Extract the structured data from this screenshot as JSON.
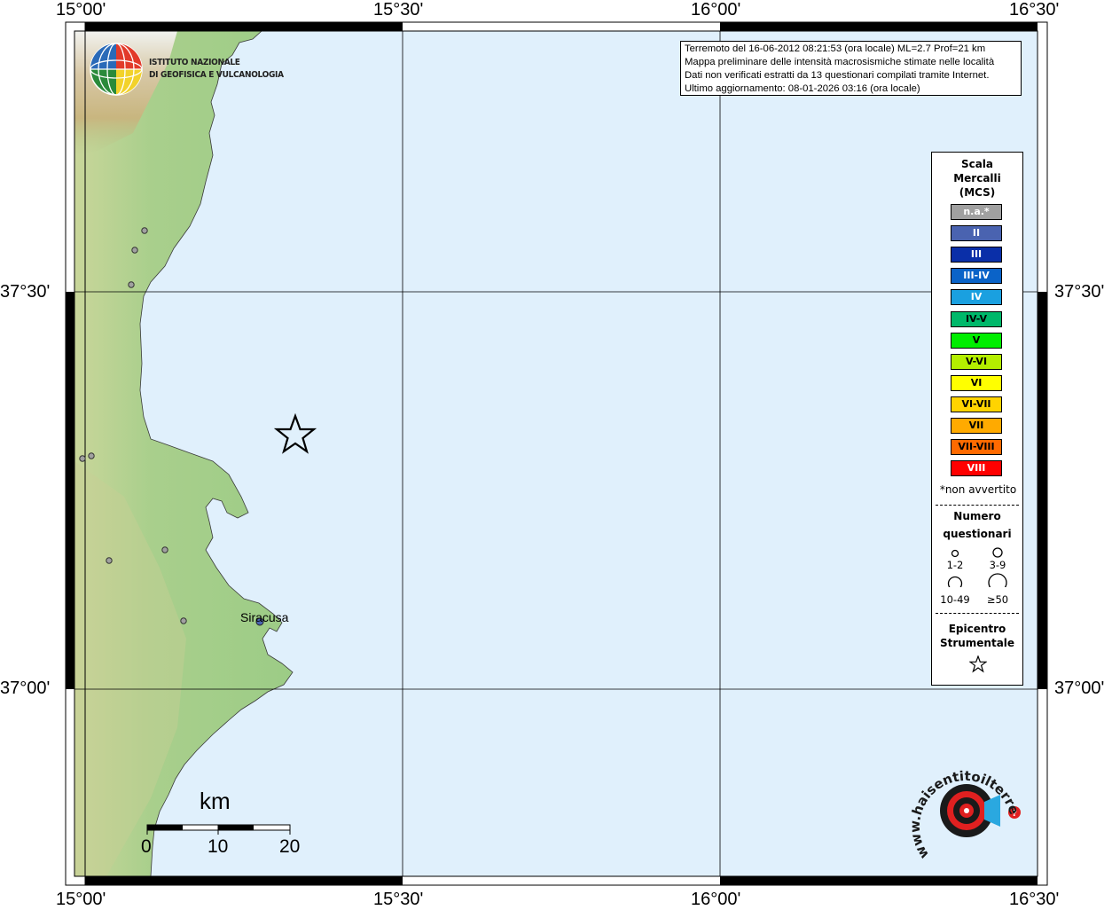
{
  "header": {
    "line1": "Terremoto del 16-06-2012 08:21:53 (ora locale) ML=2.7 Prof=21 km",
    "line2": "Mappa preliminare delle intensità macrosismiche stimate nelle località",
    "line3": "Dati non verificati estratti da 13 questionari compilati tramite Internet.",
    "line4": "Ultimo aggiornamento: 08-01-2026 03:16 (ora locale)"
  },
  "logo": {
    "line1": "ISTITUTO NAZIONALE",
    "line2": "DI GEOFISICA E VULCANOLOGIA",
    "site": "www.haisentitoilterremoto.it"
  },
  "axes": {
    "top": [
      "15°00'",
      "15°30'",
      "16°00'",
      "16°30'"
    ],
    "bottom": [
      "15°00'",
      "15°30'",
      "16°00'",
      "16°30'"
    ],
    "left": [
      "37°30'",
      "37°00'"
    ],
    "right": [
      "37°30'",
      "37°00'"
    ]
  },
  "legend": {
    "title_lines": [
      "Scala",
      "Mercalli",
      "(MCS)"
    ],
    "intensity_classes": [
      {
        "label": "n.a.*",
        "color": "#a0a0a0",
        "text_color": "#ffffff"
      },
      {
        "label": "II",
        "color": "#4a63b0",
        "text_color": "#ffffff"
      },
      {
        "label": "III",
        "color": "#0a2fa8",
        "text_color": "#ffffff"
      },
      {
        "label": "III-IV",
        "color": "#0a63c8",
        "text_color": "#ffffff"
      },
      {
        "label": "IV",
        "color": "#1aa0e0",
        "text_color": "#ffffff"
      },
      {
        "label": "IV-V",
        "color": "#00b86a",
        "text_color": "#000000"
      },
      {
        "label": "V",
        "color": "#00ee00",
        "text_color": "#000000"
      },
      {
        "label": "V-VI",
        "color": "#b4ee00",
        "text_color": "#000000"
      },
      {
        "label": "VI",
        "color": "#ffff00",
        "text_color": "#000000"
      },
      {
        "label": "VI-VII",
        "color": "#ffd400",
        "text_color": "#000000"
      },
      {
        "label": "VII",
        "color": "#ffaa00",
        "text_color": "#000000"
      },
      {
        "label": "VII-VIII",
        "color": "#ff6a00",
        "text_color": "#000000"
      },
      {
        "label": "VIII",
        "color": "#ff0000",
        "text_color": "#ffffff"
      }
    ],
    "note": "*non avvertito",
    "questionnaire_title_lines": [
      "Numero",
      "questionari"
    ],
    "questionnaire_classes": [
      "1-2",
      "3-9",
      "10-49",
      "≥50"
    ],
    "epicenter_title_lines": [
      "Epicentro",
      "Strumentale"
    ]
  },
  "map": {
    "place_label": "Siracusa",
    "scale_unit": "km",
    "scale_ticks": [
      "0",
      "10",
      "20"
    ],
    "sea_color": "#e0f0fc",
    "land_color": "#a8cf8a"
  }
}
